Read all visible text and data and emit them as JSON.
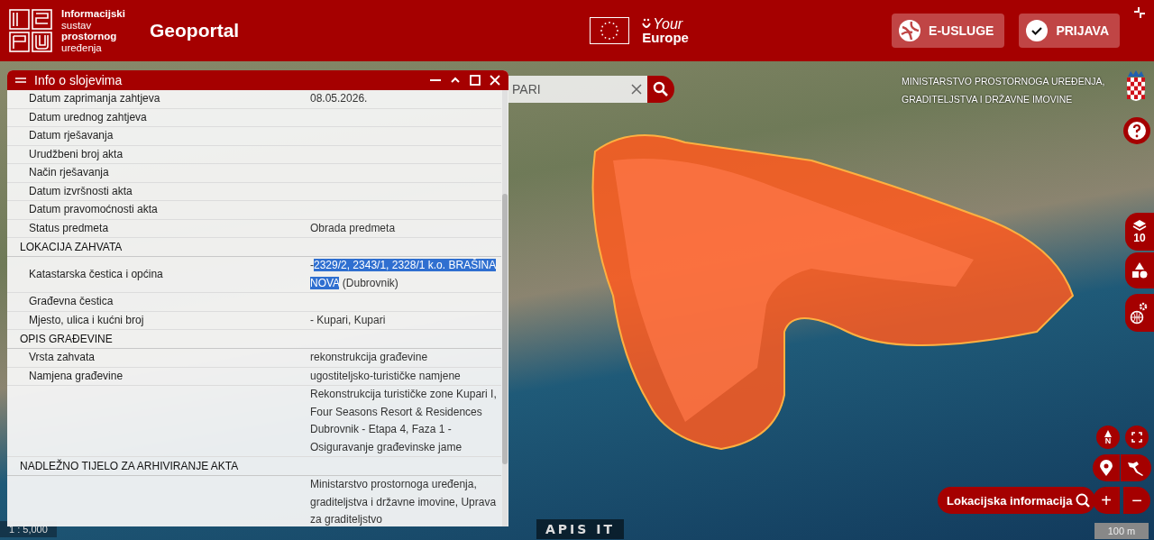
{
  "header": {
    "logo_lines": [
      {
        "text": "Informacijski",
        "bold": true
      },
      {
        "text": "sustav",
        "bold": false
      },
      {
        "text": "prostornog",
        "bold": true
      },
      {
        "text": "uređenja",
        "bold": false
      }
    ],
    "title": "Geoportal",
    "your_europe": {
      "line_1": "Your",
      "line_2": "Europe"
    },
    "buttons": [
      {
        "label": "E-USLUGE",
        "kind": "services"
      },
      {
        "label": "PRIJAVA",
        "kind": "login"
      }
    ]
  },
  "map": {
    "search": {
      "value": "PARI"
    },
    "ministry_label": [
      "MINISTARSTVO PROSTORNOGA UREĐENJA,",
      "GRADITELJSTVA I DRŽAVNE IMOVINE"
    ],
    "layers_count": "10",
    "north_label": "N",
    "location_button": "Lokacijska informacija",
    "zoom_in": "+",
    "zoom_out": "−",
    "scale_ratio": "1 : 5,000",
    "scale_bar": "100 m",
    "footer_logo": "APIS IT"
  },
  "panel": {
    "title": "Info o slojevima",
    "rows": [
      {
        "kind": "field",
        "label": "Datum zaprimanja zahtjeva",
        "value": "08.05.2026."
      },
      {
        "kind": "field",
        "label": "Datum urednog zahtjeva"
      },
      {
        "kind": "field",
        "label": "Datum rješavanja"
      },
      {
        "kind": "field",
        "label": "Urudžbeni broj akta"
      },
      {
        "kind": "field",
        "label": "Način rješavanja"
      },
      {
        "kind": "field",
        "label": "Datum izvršnosti akta"
      },
      {
        "kind": "field",
        "label": "Datum pravomoćnosti akta"
      },
      {
        "kind": "field",
        "label": "Status predmeta",
        "value": "Obrada predmeta"
      },
      {
        "kind": "section",
        "label": "LOKACIJA ZAHVATA"
      },
      {
        "kind": "field",
        "label": "Katastarska čestica i općina",
        "value_parts": [
          {
            "text": "-",
            "selected": false
          },
          {
            "text": "2329/2, 2343/1, 2328/1 k.o. BRAŠINA NOVA",
            "selected": true
          },
          {
            "text": " (Dubrovnik)",
            "selected": false
          }
        ]
      },
      {
        "kind": "field",
        "label": "Građevna čestica"
      },
      {
        "kind": "field",
        "label": "Mjesto, ulica i kućni broj",
        "value": "- Kupari, Kupari"
      },
      {
        "kind": "section",
        "label": "OPIS GRAĐEVINE"
      },
      {
        "kind": "field",
        "label": "Vrsta zahvata",
        "value": "rekonstrukcija građevine"
      },
      {
        "kind": "field",
        "label": "Namjena građevine",
        "value": "ugostiteljsko-turističke namjene"
      },
      {
        "kind": "field",
        "value": "Rekonstrukcija turističke zone Kupari I, Four Seasons Resort & Residences Dubrovnik - Etapa 4, Faza 1 - Osiguravanje građevinske jame"
      },
      {
        "kind": "section",
        "label": "NADLEŽNO TIJELO ZA ARHIVIRANJE AKTA"
      },
      {
        "kind": "field",
        "value": "Ministarstvo prostornoga uređenja, graditeljstva i državne imovine, Uprava za graditeljstvo"
      }
    ]
  }
}
